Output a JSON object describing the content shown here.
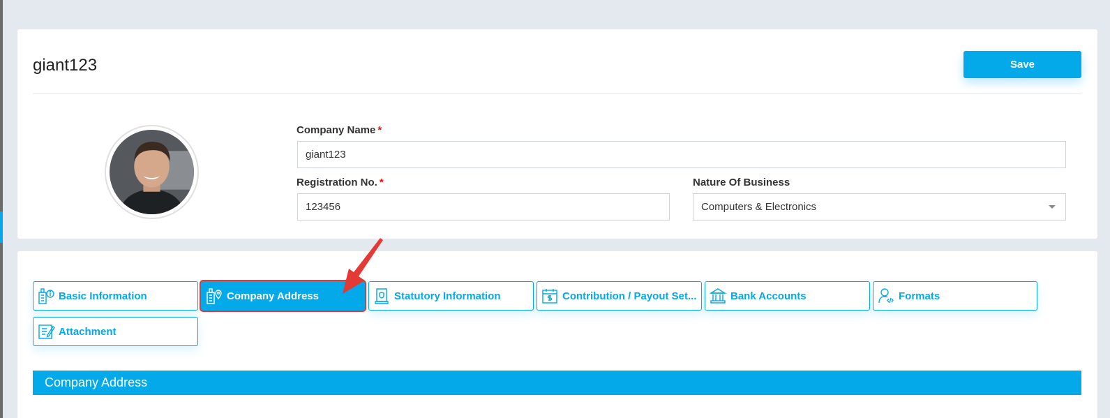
{
  "header": {
    "company_title": "giant123",
    "save_label": "Save"
  },
  "form": {
    "company_name": {
      "label": "Company Name",
      "required_mark": "*",
      "value": "giant123"
    },
    "registration_no": {
      "label": "Registration No.",
      "required_mark": "*",
      "value": "123456"
    },
    "nature_of_business": {
      "label": "Nature Of Business",
      "value": "Computers & Electronics"
    }
  },
  "tabs": [
    {
      "label": "Basic Information",
      "icon": "building-info-icon"
    },
    {
      "label": "Company Address",
      "icon": "building-location-icon",
      "active": true
    },
    {
      "label": "Statutory Information",
      "icon": "certificate-icon"
    },
    {
      "label": "Contribution / Payout Set...",
      "icon": "calendar-dollar-icon"
    },
    {
      "label": "Bank Accounts",
      "icon": "bank-icon"
    },
    {
      "label": "Formats",
      "icon": "user-code-icon"
    },
    {
      "label": "Attachment",
      "icon": "attachment-note-icon"
    }
  ],
  "section": {
    "title": "Company Address"
  },
  "colors": {
    "accent": "#03a9e8",
    "highlight": "#e53935",
    "background": "#e4e9f0"
  }
}
